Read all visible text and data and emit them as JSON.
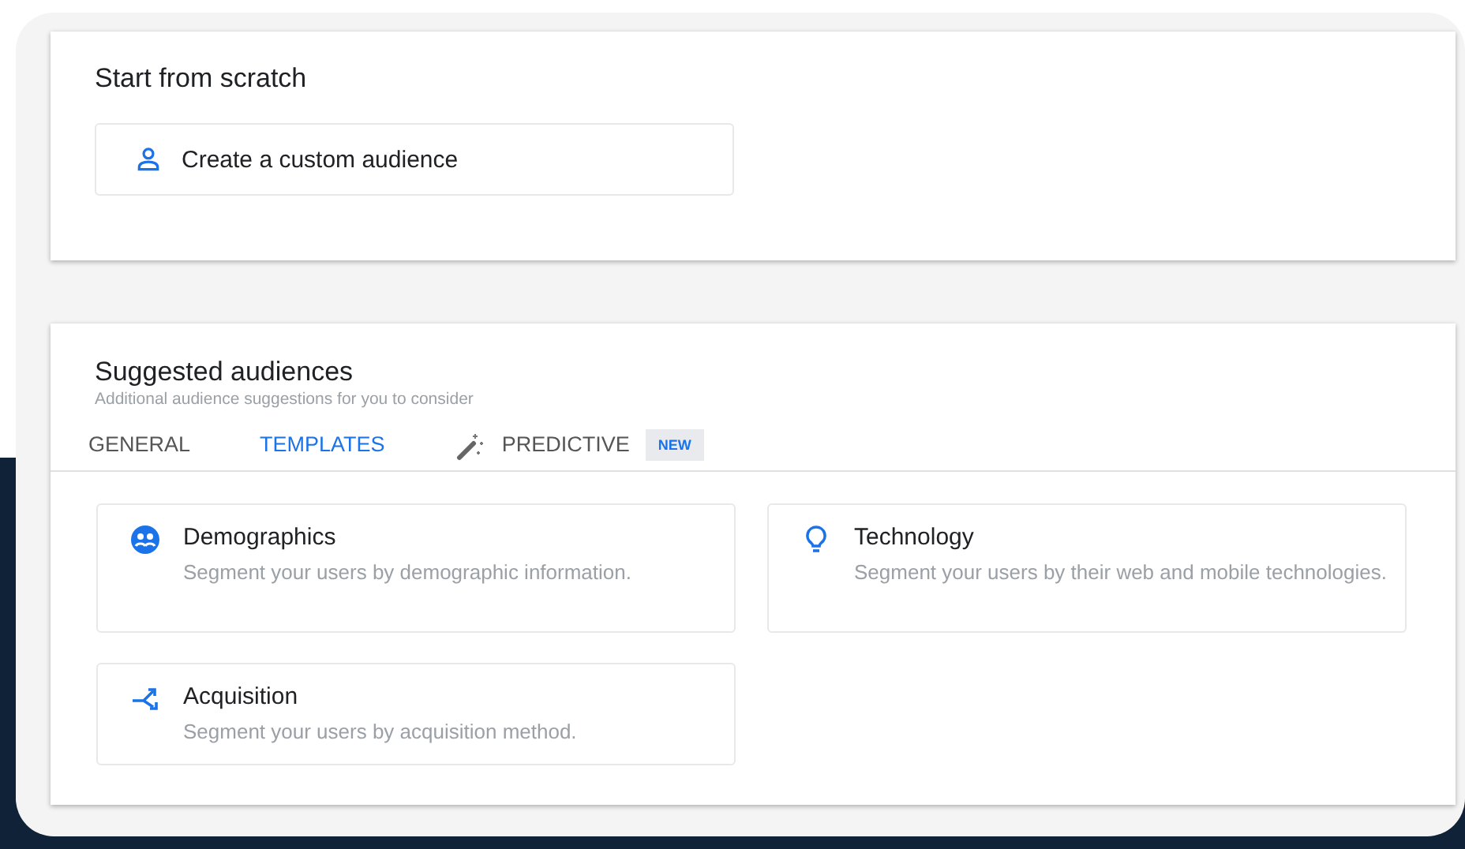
{
  "start": {
    "title": "Start from scratch",
    "action": {
      "label": "Create a custom audience"
    }
  },
  "suggested": {
    "title": "Suggested audiences",
    "subtitle": "Additional audience suggestions for you to consider",
    "tabs": [
      {
        "label": "GENERAL",
        "selected": false,
        "kind": "plain"
      },
      {
        "label": "TEMPLATES",
        "selected": true,
        "kind": "plain"
      },
      {
        "label": "PREDICTIVE",
        "selected": false,
        "kind": "wand",
        "badge": "NEW"
      }
    ],
    "templates": [
      {
        "kind": "demographics",
        "title": "Demographics",
        "description": "Segment your users by demographic information."
      },
      {
        "kind": "technology",
        "title": "Technology",
        "description": "Segment your users by their web and mobile technologies."
      },
      {
        "kind": "acquisition",
        "title": "Acquisition",
        "description": "Segment your users by acquisition method."
      }
    ]
  }
}
